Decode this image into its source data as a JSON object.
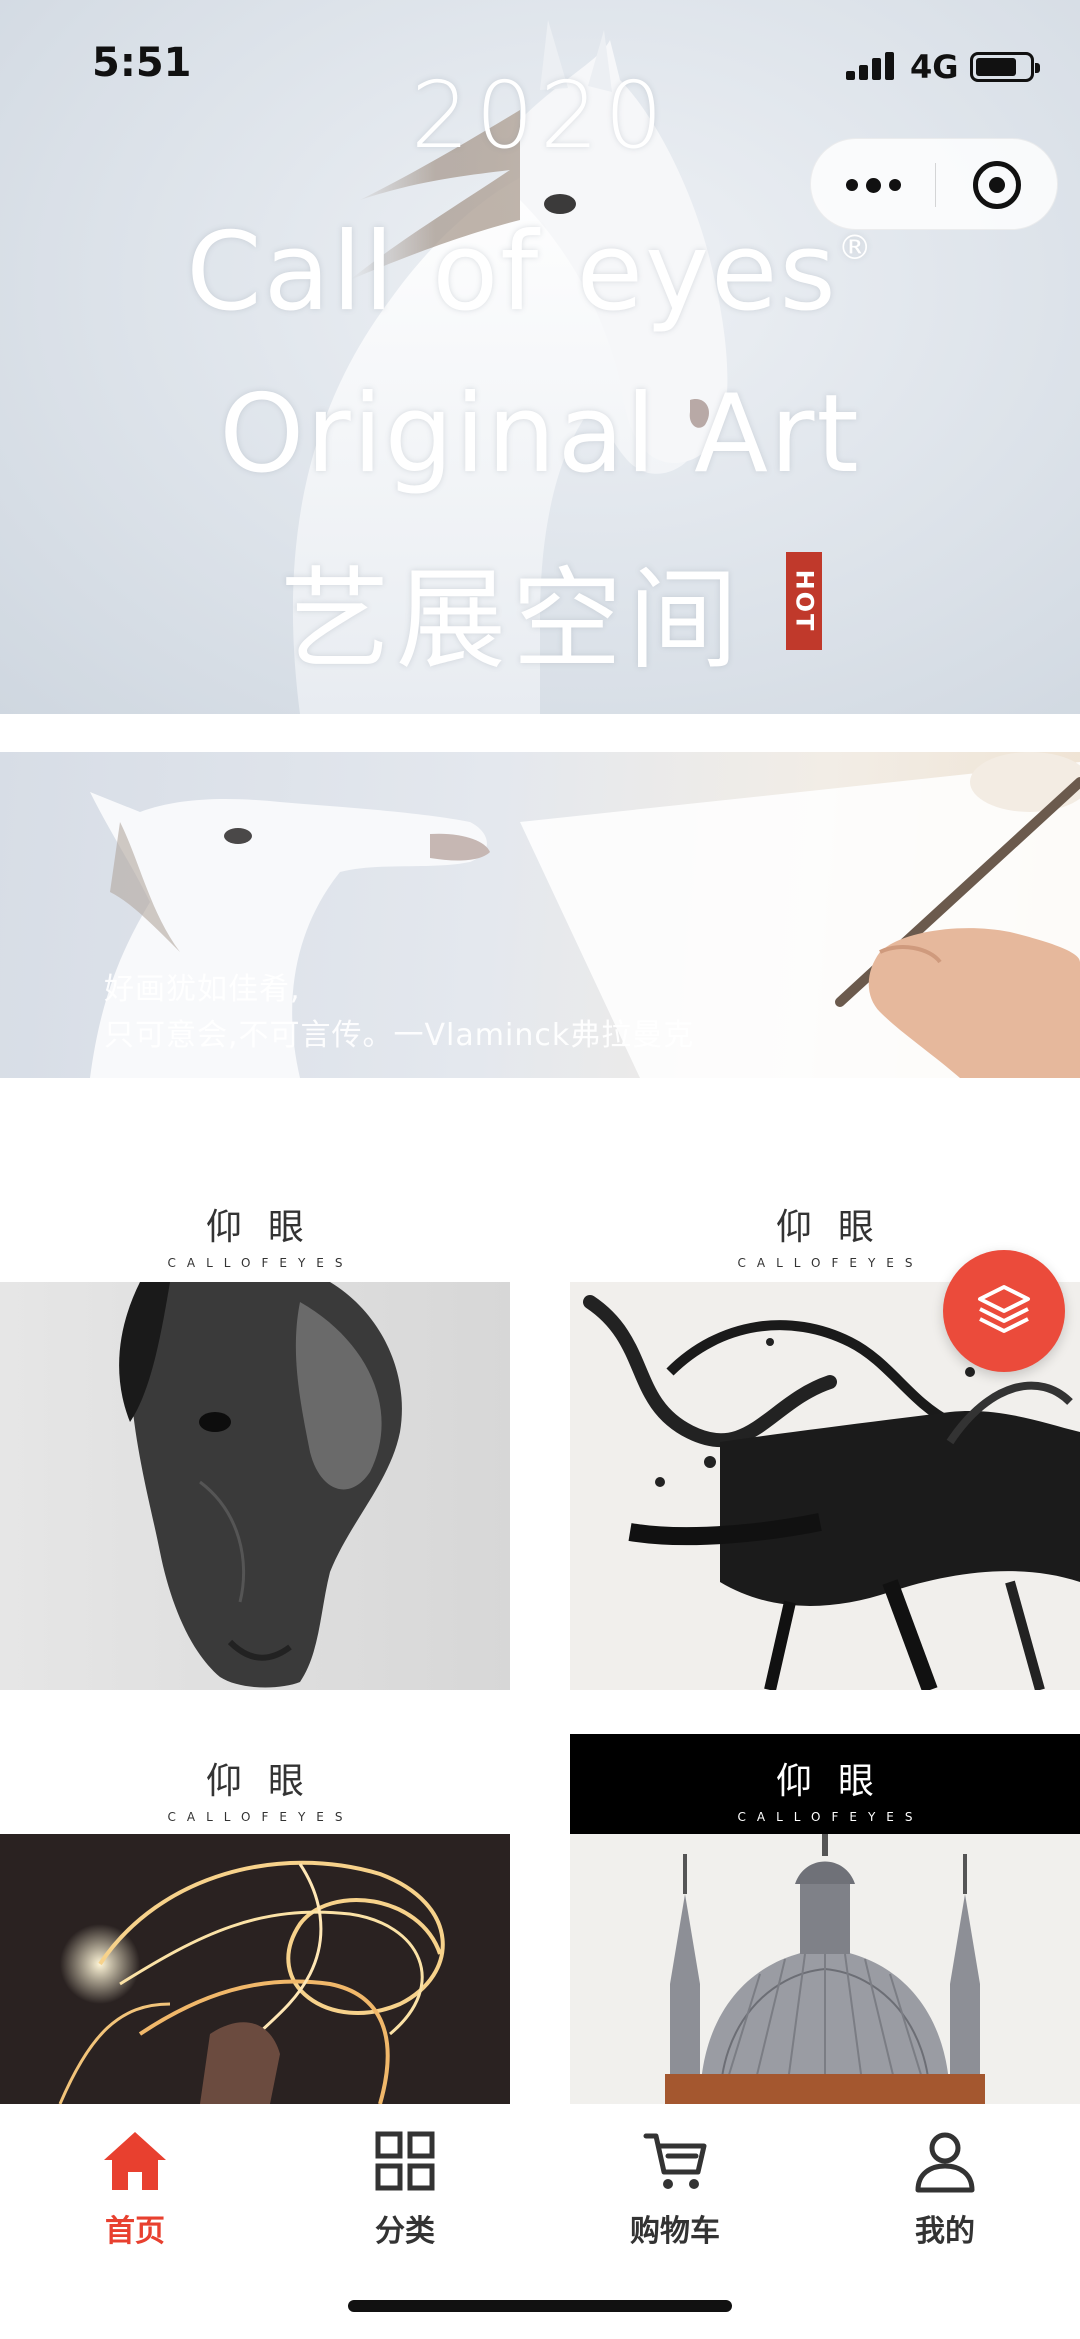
{
  "status_bar": {
    "time": "5:51",
    "network": "4G",
    "battery_level": 0.8
  },
  "capsule": {
    "more_icon": "more-dots-icon",
    "close_icon": "target-close-icon"
  },
  "hero": {
    "year": "2020",
    "line1": "Call of eyes",
    "registered": "®",
    "line2": "Original Art",
    "cn_title": "艺展空间",
    "hot_badge": "HOT"
  },
  "quote_banner": {
    "line1": "好画犹如佳肴,",
    "line2": "只可意会,不可言传。一Vlaminck弗拉曼克"
  },
  "cards": [
    {
      "logo_cn": "仰眼",
      "logo_en": "CALLOFEYES",
      "image": "black-white horse head photograph"
    },
    {
      "logo_cn": "仰眼",
      "logo_en": "CALLOFEYES",
      "image": "abstract ink horse painting"
    },
    {
      "logo_cn": "仰眼",
      "logo_en": "CALLOFEYES",
      "image": "light painting horse and rider"
    },
    {
      "logo_cn": "仰眼",
      "logo_en": "CALLOFEYES",
      "image": "domed cathedral drawing"
    }
  ],
  "fab": {
    "icon": "layers-icon",
    "color": "#eb4b3b"
  },
  "tabbar": {
    "active_color": "#e8402f",
    "items": [
      {
        "label": "首页",
        "icon": "home-icon",
        "active": true
      },
      {
        "label": "分类",
        "icon": "grid-icon",
        "active": false
      },
      {
        "label": "购物车",
        "icon": "cart-icon",
        "active": false
      },
      {
        "label": "我的",
        "icon": "user-icon",
        "active": false
      }
    ]
  }
}
